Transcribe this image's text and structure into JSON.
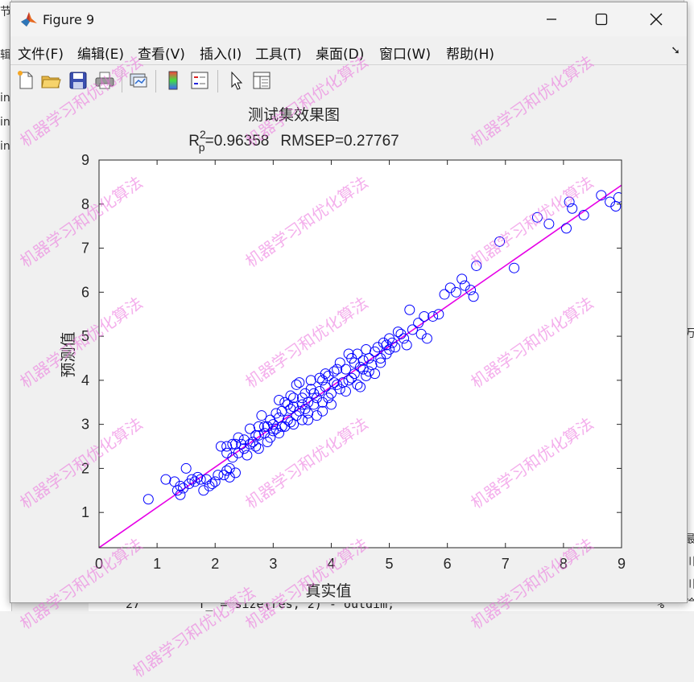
{
  "window": {
    "title": "Figure 9"
  },
  "menu": {
    "items": [
      "文件(F)",
      "编辑(E)",
      "查看(V)",
      "插入(I)",
      "工具(T)",
      "桌面(D)",
      "窗口(W)",
      "帮助(H)"
    ]
  },
  "toolbar": {
    "icons": [
      "new-figure-icon",
      "open-file-icon",
      "save-icon",
      "print-icon",
      "link-plot-icon",
      "insert-colorbar-icon",
      "insert-legend-icon",
      "edit-plot-icon",
      "property-inspector-icon"
    ]
  },
  "colors": {
    "marker": "#0000ff",
    "fit_line": "#e600e6",
    "watermark": "#eb6edc"
  },
  "watermark": {
    "text": "机器学习和优化算法"
  },
  "background": {
    "left_fragments": [
      "节",
      "辑",
      "in",
      "in",
      "in"
    ],
    "right_fragments": [
      "万",
      "最",
      "川",
      "川",
      "输"
    ],
    "bottom_code": "27        f_ = size(res, 2) - outdim;",
    "bottom_right": "%"
  },
  "chart_data": {
    "type": "scatter",
    "title": "测试集效果图",
    "subtitle": {
      "r_symbol": "R",
      "sup": "2",
      "sub": "p",
      "r_value": "=0.96358",
      "rmsep": "RMSEP=0.27767"
    },
    "xlabel": "真实值",
    "ylabel": "预测值",
    "xlim": [
      0,
      9
    ],
    "ylim": [
      0.2,
      9
    ],
    "xticks": [
      0,
      1,
      2,
      3,
      4,
      5,
      6,
      7,
      8,
      9
    ],
    "yticks": [
      1,
      2,
      3,
      4,
      5,
      6,
      7,
      8,
      9
    ],
    "fit_line": {
      "x": [
        0,
        9
      ],
      "y": [
        0.2,
        8.43
      ]
    },
    "points": [
      [
        0.85,
        1.3
      ],
      [
        1.15,
        1.75
      ],
      [
        1.3,
        1.7
      ],
      [
        1.35,
        1.5
      ],
      [
        1.4,
        1.6
      ],
      [
        1.45,
        1.55
      ],
      [
        1.5,
        2.0
      ],
      [
        1.4,
        1.4
      ],
      [
        1.55,
        1.65
      ],
      [
        1.6,
        1.75
      ],
      [
        1.65,
        1.7
      ],
      [
        1.7,
        1.8
      ],
      [
        1.75,
        1.75
      ],
      [
        1.8,
        1.5
      ],
      [
        1.9,
        1.6
      ],
      [
        2.0,
        1.7
      ],
      [
        2.1,
        2.5
      ],
      [
        2.15,
        1.85
      ],
      [
        2.2,
        2.5
      ],
      [
        2.25,
        2.0
      ],
      [
        2.25,
        1.8
      ],
      [
        2.3,
        2.25
      ],
      [
        2.35,
        2.55
      ],
      [
        2.4,
        2.7
      ],
      [
        2.45,
        2.55
      ],
      [
        2.5,
        2.45
      ],
      [
        2.55,
        2.3
      ],
      [
        2.6,
        2.9
      ],
      [
        2.65,
        2.6
      ],
      [
        2.7,
        2.5
      ],
      [
        2.75,
        2.45
      ],
      [
        2.75,
        2.75
      ],
      [
        2.8,
        3.2
      ],
      [
        2.85,
        2.8
      ],
      [
        2.9,
        2.6
      ],
      [
        2.95,
        2.7
      ],
      [
        3.0,
        3.0
      ],
      [
        3.05,
        2.9
      ],
      [
        3.1,
        3.15
      ],
      [
        3.1,
        2.8
      ],
      [
        3.15,
        3.3
      ],
      [
        3.2,
        2.95
      ],
      [
        3.2,
        3.5
      ],
      [
        3.25,
        3.1
      ],
      [
        3.3,
        3.35
      ],
      [
        3.3,
        3.05
      ],
      [
        3.35,
        3.6
      ],
      [
        3.4,
        3.2
      ],
      [
        3.4,
        3.9
      ],
      [
        3.45,
        3.3
      ],
      [
        3.5,
        3.45
      ],
      [
        3.5,
        3.1
      ],
      [
        3.55,
        3.7
      ],
      [
        3.6,
        3.5
      ],
      [
        3.6,
        3.25
      ],
      [
        3.65,
        3.8
      ],
      [
        3.7,
        3.45
      ],
      [
        3.75,
        3.2
      ],
      [
        3.75,
        3.6
      ],
      [
        3.8,
        3.75
      ],
      [
        3.85,
        4.0
      ],
      [
        3.85,
        3.5
      ],
      [
        3.9,
        3.85
      ],
      [
        3.95,
        4.1
      ],
      [
        4.0,
        3.7
      ],
      [
        4.0,
        3.45
      ],
      [
        4.05,
        4.2
      ],
      [
        4.1,
        3.9
      ],
      [
        4.15,
        4.4
      ],
      [
        4.2,
        3.95
      ],
      [
        4.25,
        4.25
      ],
      [
        4.3,
        4.0
      ],
      [
        4.35,
        4.5
      ],
      [
        4.4,
        4.15
      ],
      [
        4.45,
        4.6
      ],
      [
        4.5,
        4.3
      ],
      [
        4.5,
        3.85
      ],
      [
        4.55,
        4.45
      ],
      [
        4.6,
        4.1
      ],
      [
        4.6,
        4.7
      ],
      [
        4.65,
        4.5
      ],
      [
        4.7,
        4.35
      ],
      [
        4.75,
        4.65
      ],
      [
        4.8,
        4.75
      ],
      [
        4.85,
        4.5
      ],
      [
        4.9,
        4.85
      ],
      [
        4.95,
        4.6
      ],
      [
        5.0,
        4.7
      ],
      [
        5.0,
        4.95
      ],
      [
        5.05,
        4.85
      ],
      [
        5.1,
        4.75
      ],
      [
        5.2,
        5.05
      ],
      [
        5.3,
        4.8
      ],
      [
        5.35,
        5.6
      ],
      [
        5.4,
        5.15
      ],
      [
        5.5,
        5.3
      ],
      [
        5.55,
        5.05
      ],
      [
        5.6,
        5.45
      ],
      [
        5.65,
        4.95
      ],
      [
        5.75,
        5.45
      ],
      [
        5.85,
        5.5
      ],
      [
        5.95,
        5.95
      ],
      [
        6.05,
        6.1
      ],
      [
        6.15,
        6.0
      ],
      [
        6.25,
        6.3
      ],
      [
        6.3,
        6.15
      ],
      [
        6.4,
        6.05
      ],
      [
        6.45,
        5.9
      ],
      [
        6.5,
        6.6
      ],
      [
        6.9,
        7.15
      ],
      [
        7.15,
        6.55
      ],
      [
        7.55,
        7.7
      ],
      [
        7.75,
        7.55
      ],
      [
        8.05,
        7.45
      ],
      [
        8.1,
        8.05
      ],
      [
        8.15,
        7.9
      ],
      [
        8.35,
        7.75
      ],
      [
        8.65,
        8.2
      ],
      [
        8.8,
        8.05
      ],
      [
        8.9,
        7.95
      ],
      [
        8.95,
        8.15
      ],
      [
        4.3,
        4.6
      ],
      [
        4.1,
        4.25
      ],
      [
        3.95,
        3.6
      ],
      [
        3.7,
        3.7
      ],
      [
        3.55,
        3.35
      ],
      [
        3.35,
        3.4
      ],
      [
        3.25,
        3.45
      ],
      [
        3.15,
        2.95
      ],
      [
        3.05,
        3.25
      ],
      [
        2.95,
        3.1
      ],
      [
        2.85,
        2.95
      ],
      [
        2.7,
        2.75
      ],
      [
        2.6,
        2.55
      ],
      [
        2.5,
        2.65
      ],
      [
        2.4,
        2.35
      ],
      [
        2.3,
        2.55
      ],
      [
        2.2,
        2.35
      ],
      [
        2.35,
        1.9
      ],
      [
        2.2,
        1.95
      ],
      [
        2.05,
        1.85
      ],
      [
        1.95,
        1.65
      ],
      [
        1.85,
        1.75
      ],
      [
        4.15,
        3.8
      ],
      [
        4.25,
        3.75
      ],
      [
        4.4,
        4.4
      ],
      [
        4.55,
        4.25
      ],
      [
        4.65,
        4.2
      ],
      [
        4.75,
        4.15
      ],
      [
        4.85,
        4.4
      ],
      [
        4.95,
        4.8
      ],
      [
        5.15,
        5.1
      ],
      [
        5.25,
        4.95
      ],
      [
        3.45,
        3.95
      ],
      [
        3.65,
        4.0
      ],
      [
        3.8,
        4.05
      ],
      [
        3.9,
        4.15
      ],
      [
        3.5,
        3.6
      ],
      [
        3.3,
        3.65
      ],
      [
        3.1,
        3.55
      ],
      [
        3.0,
        2.85
      ],
      [
        2.9,
        2.95
      ],
      [
        2.75,
        2.95
      ],
      [
        3.35,
        3.0
      ],
      [
        3.6,
        3.1
      ],
      [
        3.85,
        3.3
      ],
      [
        4.05,
        3.95
      ],
      [
        4.35,
        4.05
      ],
      [
        4.45,
        3.9
      ]
    ]
  }
}
